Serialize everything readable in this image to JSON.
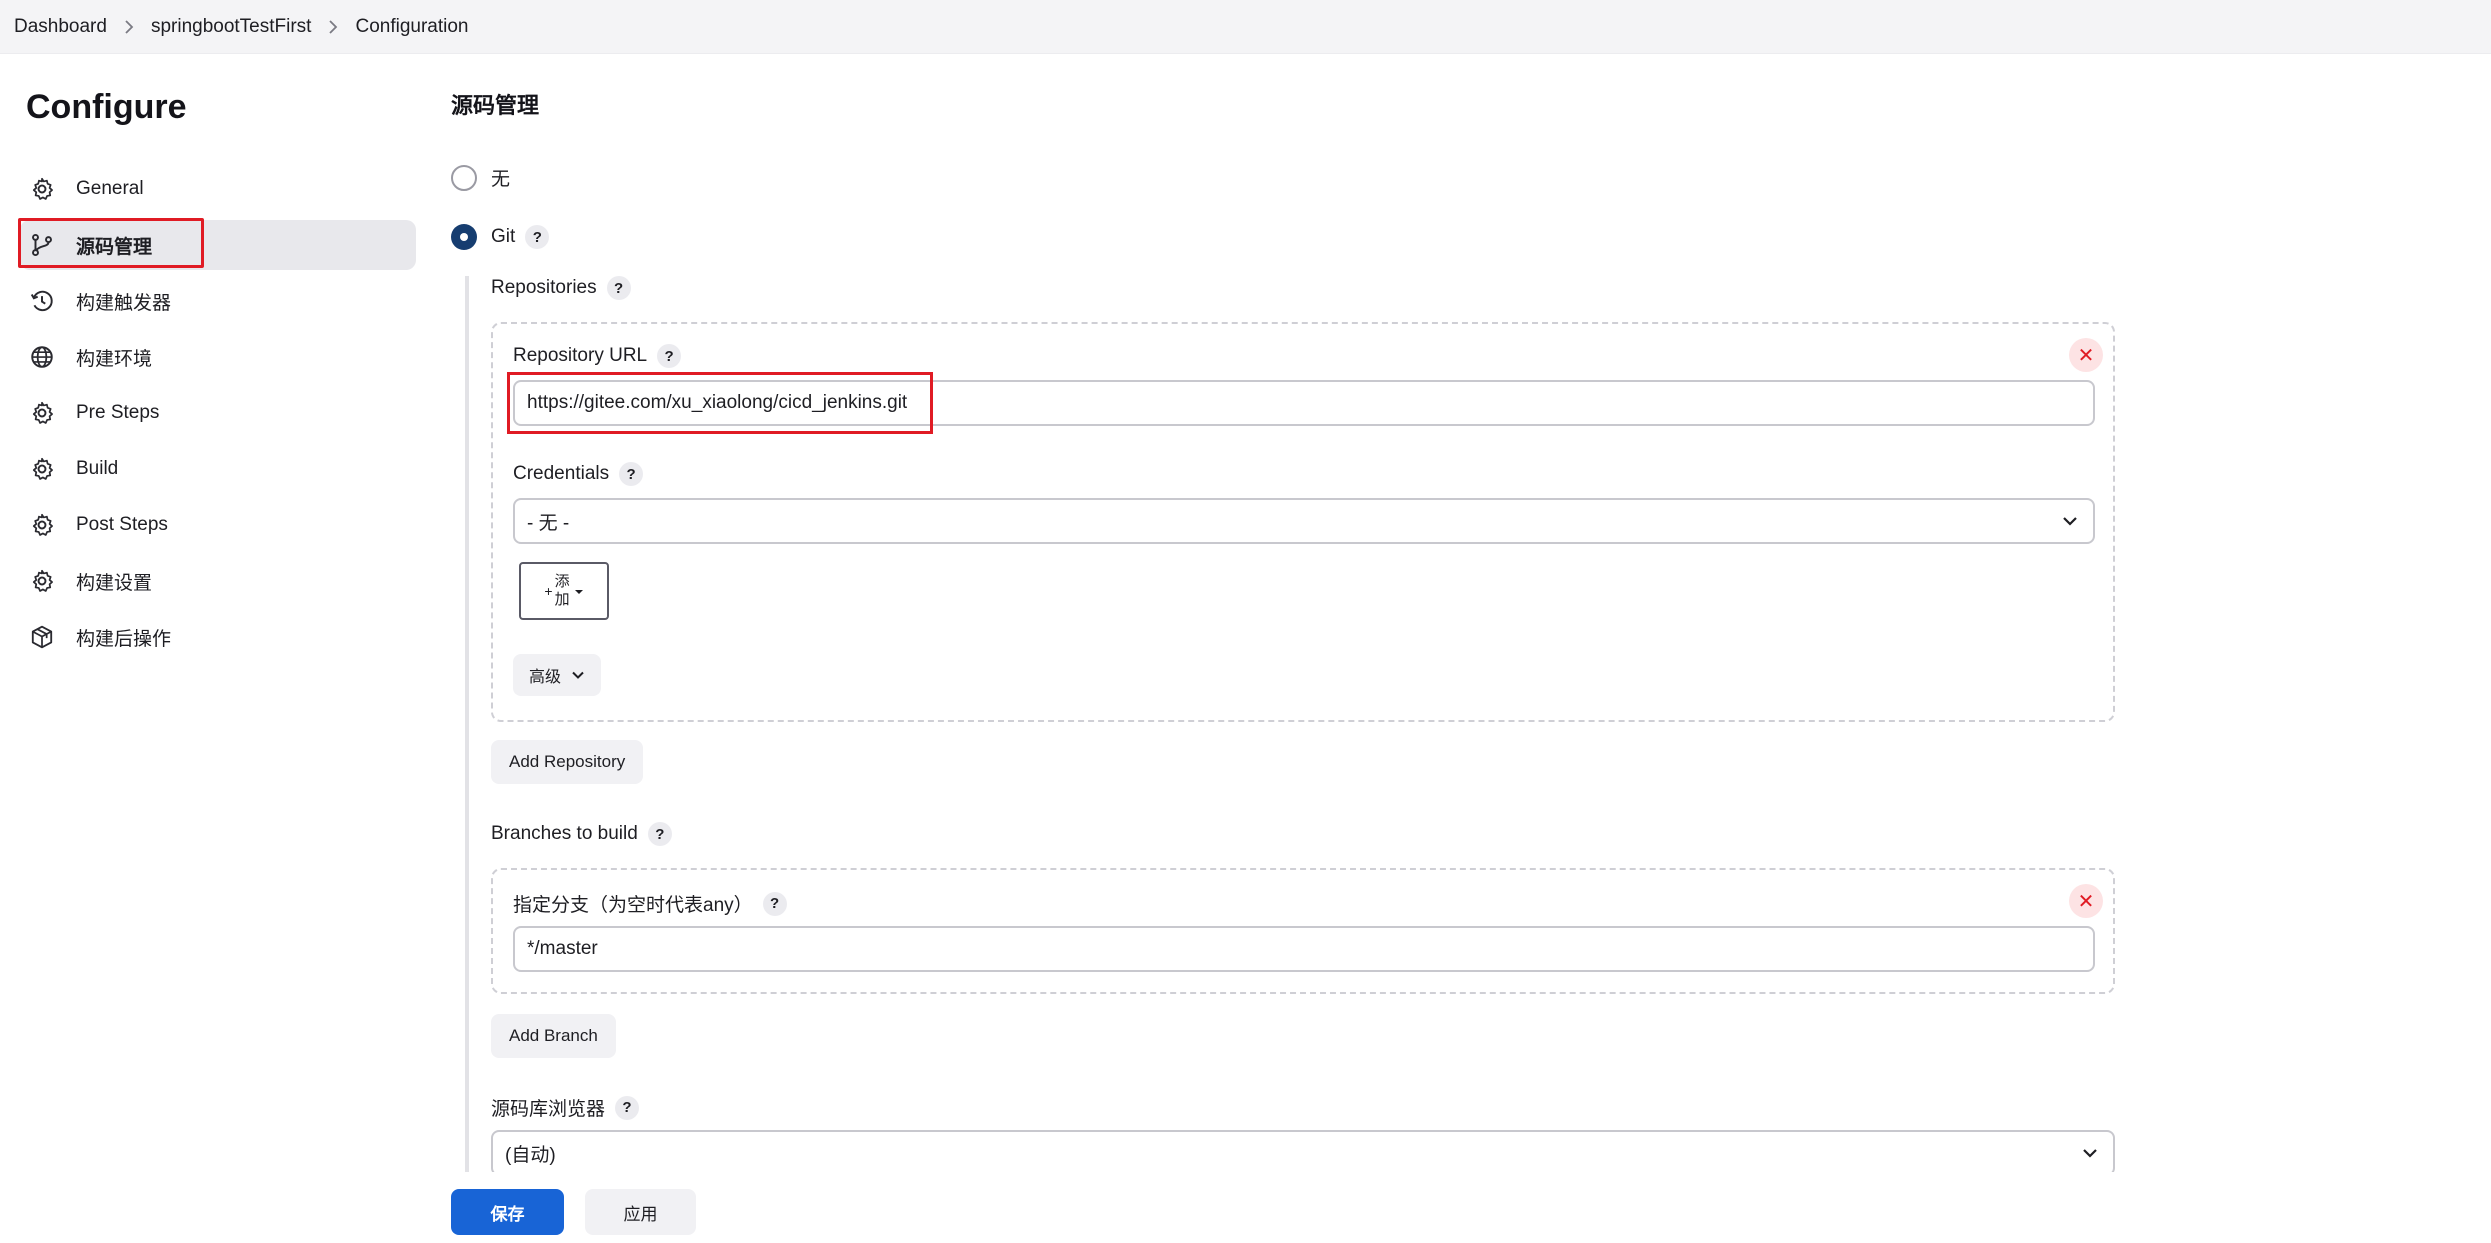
{
  "breadcrumb": [
    "Dashboard",
    "springbootTestFirst",
    "Configuration"
  ],
  "page_title": "Configure",
  "sidebar": {
    "items": [
      {
        "label": "General",
        "icon": "gear-icon"
      },
      {
        "label": "源码管理",
        "icon": "git-branch-icon",
        "active": true
      },
      {
        "label": "构建触发器",
        "icon": "clock-icon"
      },
      {
        "label": "构建环境",
        "icon": "globe-icon"
      },
      {
        "label": "Pre Steps",
        "icon": "gear-icon"
      },
      {
        "label": "Build",
        "icon": "gear-icon"
      },
      {
        "label": "Post Steps",
        "icon": "gear-icon"
      },
      {
        "label": "构建设置",
        "icon": "gear-icon"
      },
      {
        "label": "构建后操作",
        "icon": "package-icon"
      }
    ]
  },
  "scm": {
    "section_title": "源码管理",
    "option_none": "无",
    "option_git": "Git",
    "help": "?",
    "repositories_label": "Repositories",
    "repository_url_label": "Repository URL",
    "repository_url_value": "https://gitee.com/xu_xiaolong/cicd_jenkins.git",
    "credentials_label": "Credentials",
    "credentials_value": "- 无 -",
    "add_btn_plus": "+",
    "add_btn_line1": "添",
    "add_btn_line2": "加",
    "advanced_label": "高级",
    "add_repository": "Add Repository",
    "branches_label": "Branches to build",
    "branch_specifier_label": "指定分支（为空时代表any）",
    "branch_specifier_value": "*/master",
    "add_branch": "Add Branch",
    "browser_label": "源码库浏览器",
    "browser_value": "(自动)"
  },
  "footer": {
    "save": "保存",
    "apply": "应用"
  },
  "colors": {
    "accent": "#1864d6",
    "highlight": "#e01b24",
    "radio_checked": "#163d70"
  }
}
